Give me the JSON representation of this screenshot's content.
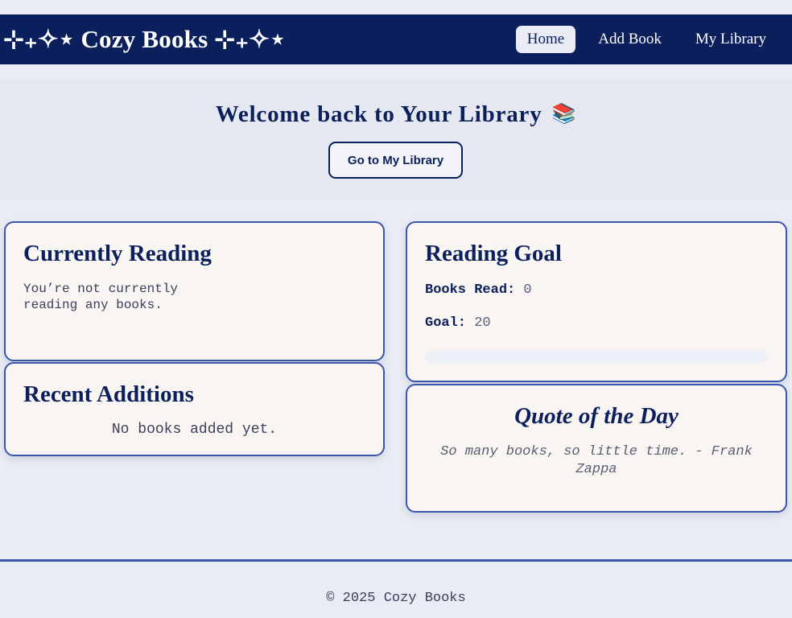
{
  "navbar": {
    "brand": "⊹₊✧⋆ Cozy Books ⊹₊✧⋆",
    "links": [
      {
        "label": "Home",
        "active": true
      },
      {
        "label": "Add Book",
        "active": false
      },
      {
        "label": "My Library",
        "active": false
      }
    ]
  },
  "hero": {
    "title": "Welcome back to Your Library",
    "icon": "📚",
    "button_label": "Go to My Library"
  },
  "currently_reading": {
    "title": "Currently Reading",
    "message": "You’re not currently reading any books."
  },
  "recent_additions": {
    "title": "Recent Additions",
    "message": "No books added yet."
  },
  "reading_goal": {
    "title": "Reading Goal",
    "books_read_label": "Books Read:",
    "books_read_value": "0",
    "goal_label": "Goal:",
    "goal_value": "20",
    "progress_fraction": 0
  },
  "quote": {
    "title": "Quote of the Day",
    "text": "So many books, so little time. - Frank Zappa"
  },
  "footer": {
    "text": "© 2025 Cozy Books"
  },
  "colors": {
    "navy": "#0b1f5c",
    "accent": "#3a55ad",
    "background": "#e9ecf4",
    "card": "#f9f5f2"
  }
}
